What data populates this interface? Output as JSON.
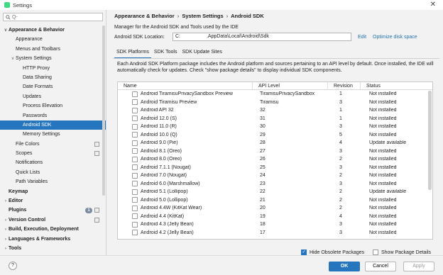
{
  "window": {
    "title": "Settings"
  },
  "sidebar": {
    "search_placeholder": "Q-",
    "items": [
      {
        "label": "Appearance & Behavior",
        "level": 0,
        "expanded": true,
        "bold": true
      },
      {
        "label": "Appearance",
        "level": 1
      },
      {
        "label": "Menus and Toolbars",
        "level": 1
      },
      {
        "label": "System Settings",
        "level": 1,
        "expanded": true
      },
      {
        "label": "HTTP Proxy",
        "level": 2
      },
      {
        "label": "Data Sharing",
        "level": 2
      },
      {
        "label": "Date Formats",
        "level": 2
      },
      {
        "label": "Updates",
        "level": 2
      },
      {
        "label": "Process Elevation",
        "level": 2
      },
      {
        "label": "Passwords",
        "level": 2
      },
      {
        "label": "Android SDK",
        "level": 2,
        "selected": true
      },
      {
        "label": "Memory Settings",
        "level": 2
      },
      {
        "label": "File Colors",
        "level": 1,
        "icon": true
      },
      {
        "label": "Scopes",
        "level": 1,
        "icon": true
      },
      {
        "label": "Notifications",
        "level": 1
      },
      {
        "label": "Quick Lists",
        "level": 1
      },
      {
        "label": "Path Variables",
        "level": 1
      },
      {
        "label": "Keymap",
        "level": 0,
        "bold": true,
        "leaf": true
      },
      {
        "label": "Editor",
        "level": 0,
        "bold": true,
        "collapsed": true
      },
      {
        "label": "Plugins",
        "level": 0,
        "bold": true,
        "leaf": true,
        "badge": "1",
        "icon": true
      },
      {
        "label": "Version Control",
        "level": 0,
        "bold": true,
        "collapsed": true,
        "icon": true
      },
      {
        "label": "Build, Execution, Deployment",
        "level": 0,
        "bold": true,
        "collapsed": true
      },
      {
        "label": "Languages & Frameworks",
        "level": 0,
        "bold": true,
        "collapsed": true
      },
      {
        "label": "Tools",
        "level": 0,
        "bold": true,
        "collapsed": true
      }
    ]
  },
  "main": {
    "breadcrumb": [
      "Appearance & Behavior",
      "System Settings",
      "Android SDK"
    ],
    "breadcrumb_sep": "›",
    "description": "Manager for the Android SDK and Tools used by the IDE",
    "location_label": "Android SDK Location:",
    "location_value": "C:                   .AppData\\Local\\Android\\Sdk",
    "edit_link": "Edit",
    "optimize_link": "Optimize disk space",
    "tabs": [
      "SDK Platforms",
      "SDK Tools",
      "SDK Update Sites"
    ],
    "active_tab": 0,
    "platform_description": "Each Android SDK Platform package includes the Android platform and sources pertaining to an API level by default. Once installed, the IDE will automatically check for updates. Check \"show package details\" to display individual SDK components.",
    "table": {
      "headers": [
        "Name",
        "API Level",
        "Revision",
        "Status"
      ],
      "rows": [
        {
          "name": "Android TiramisuPrivacySandbox Preview",
          "api": "TiramisuPrivacySandbox",
          "rev": "1",
          "status": "Not installed"
        },
        {
          "name": "Android Tiramisu Preview",
          "api": "Tiramisu",
          "rev": "3",
          "status": "Not installed"
        },
        {
          "name": "Android API 32",
          "api": "32",
          "rev": "1",
          "status": "Not installed"
        },
        {
          "name": "Android 12.0 (S)",
          "api": "31",
          "rev": "1",
          "status": "Not installed"
        },
        {
          "name": "Android 11.0 (R)",
          "api": "30",
          "rev": "3",
          "status": "Not installed"
        },
        {
          "name": "Android 10.0 (Q)",
          "api": "29",
          "rev": "5",
          "status": "Not installed"
        },
        {
          "name": "Android 9.0 (Pie)",
          "api": "28",
          "rev": "4",
          "status": "Update available"
        },
        {
          "name": "Android 8.1 (Oreo)",
          "api": "27",
          "rev": "3",
          "status": "Not installed"
        },
        {
          "name": "Android 8.0 (Oreo)",
          "api": "26",
          "rev": "2",
          "status": "Not installed"
        },
        {
          "name": "Android 7.1.1 (Nougat)",
          "api": "25",
          "rev": "3",
          "status": "Not installed"
        },
        {
          "name": "Android 7.0 (Nougat)",
          "api": "24",
          "rev": "2",
          "status": "Not installed"
        },
        {
          "name": "Android 6.0 (Marshmallow)",
          "api": "23",
          "rev": "3",
          "status": "Not installed"
        },
        {
          "name": "Android 5.1 (Lollipop)",
          "api": "22",
          "rev": "2",
          "status": "Update available"
        },
        {
          "name": "Android 5.0 (Lollipop)",
          "api": "21",
          "rev": "2",
          "status": "Not installed"
        },
        {
          "name": "Android 4.4W (KitKat Wear)",
          "api": "20",
          "rev": "2",
          "status": "Not installed"
        },
        {
          "name": "Android 4.4 (KitKat)",
          "api": "19",
          "rev": "4",
          "status": "Not installed"
        },
        {
          "name": "Android 4.3 (Jelly Bean)",
          "api": "18",
          "rev": "3",
          "status": "Not installed"
        },
        {
          "name": "Android 4.2 (Jelly Bean)",
          "api": "17",
          "rev": "3",
          "status": "Not installed"
        }
      ]
    },
    "hide_obsolete_label": "Hide Obsolete Packages",
    "hide_obsolete_checked": true,
    "show_details_label": "Show Package Details",
    "show_details_checked": false
  },
  "footer": {
    "help": "?",
    "ok": "OK",
    "cancel": "Cancel",
    "apply": "Apply"
  },
  "colors": {
    "accent": "#2675bf",
    "link": "#2470b3"
  }
}
